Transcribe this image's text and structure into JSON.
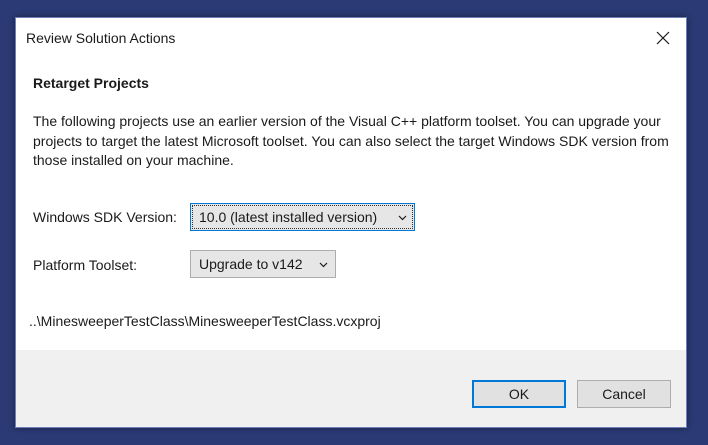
{
  "window": {
    "title": "Review Solution Actions"
  },
  "content": {
    "heading": "Retarget Projects",
    "description": "The following projects use an earlier version of the Visual C++ platform toolset.  You can upgrade your projects to target the latest Microsoft toolset.  You can also select the target Windows SDK version from those installed on your machine.",
    "sdk_label": "Windows SDK Version:",
    "sdk_value": "10.0 (latest installed version)",
    "toolset_label": "Platform Toolset:",
    "toolset_value": "Upgrade to v142",
    "project_path": "..\\MinesweeperTestClass\\MinesweeperTestClass.vcxproj"
  },
  "footer": {
    "ok_label": "OK",
    "cancel_label": "Cancel"
  },
  "icons": {
    "close": "close-icon",
    "dropdown": "chevron-down-icon"
  },
  "colors": {
    "desktop": "#2b3a75",
    "accent": "#0078d7",
    "footer": "#f0f0f0"
  }
}
